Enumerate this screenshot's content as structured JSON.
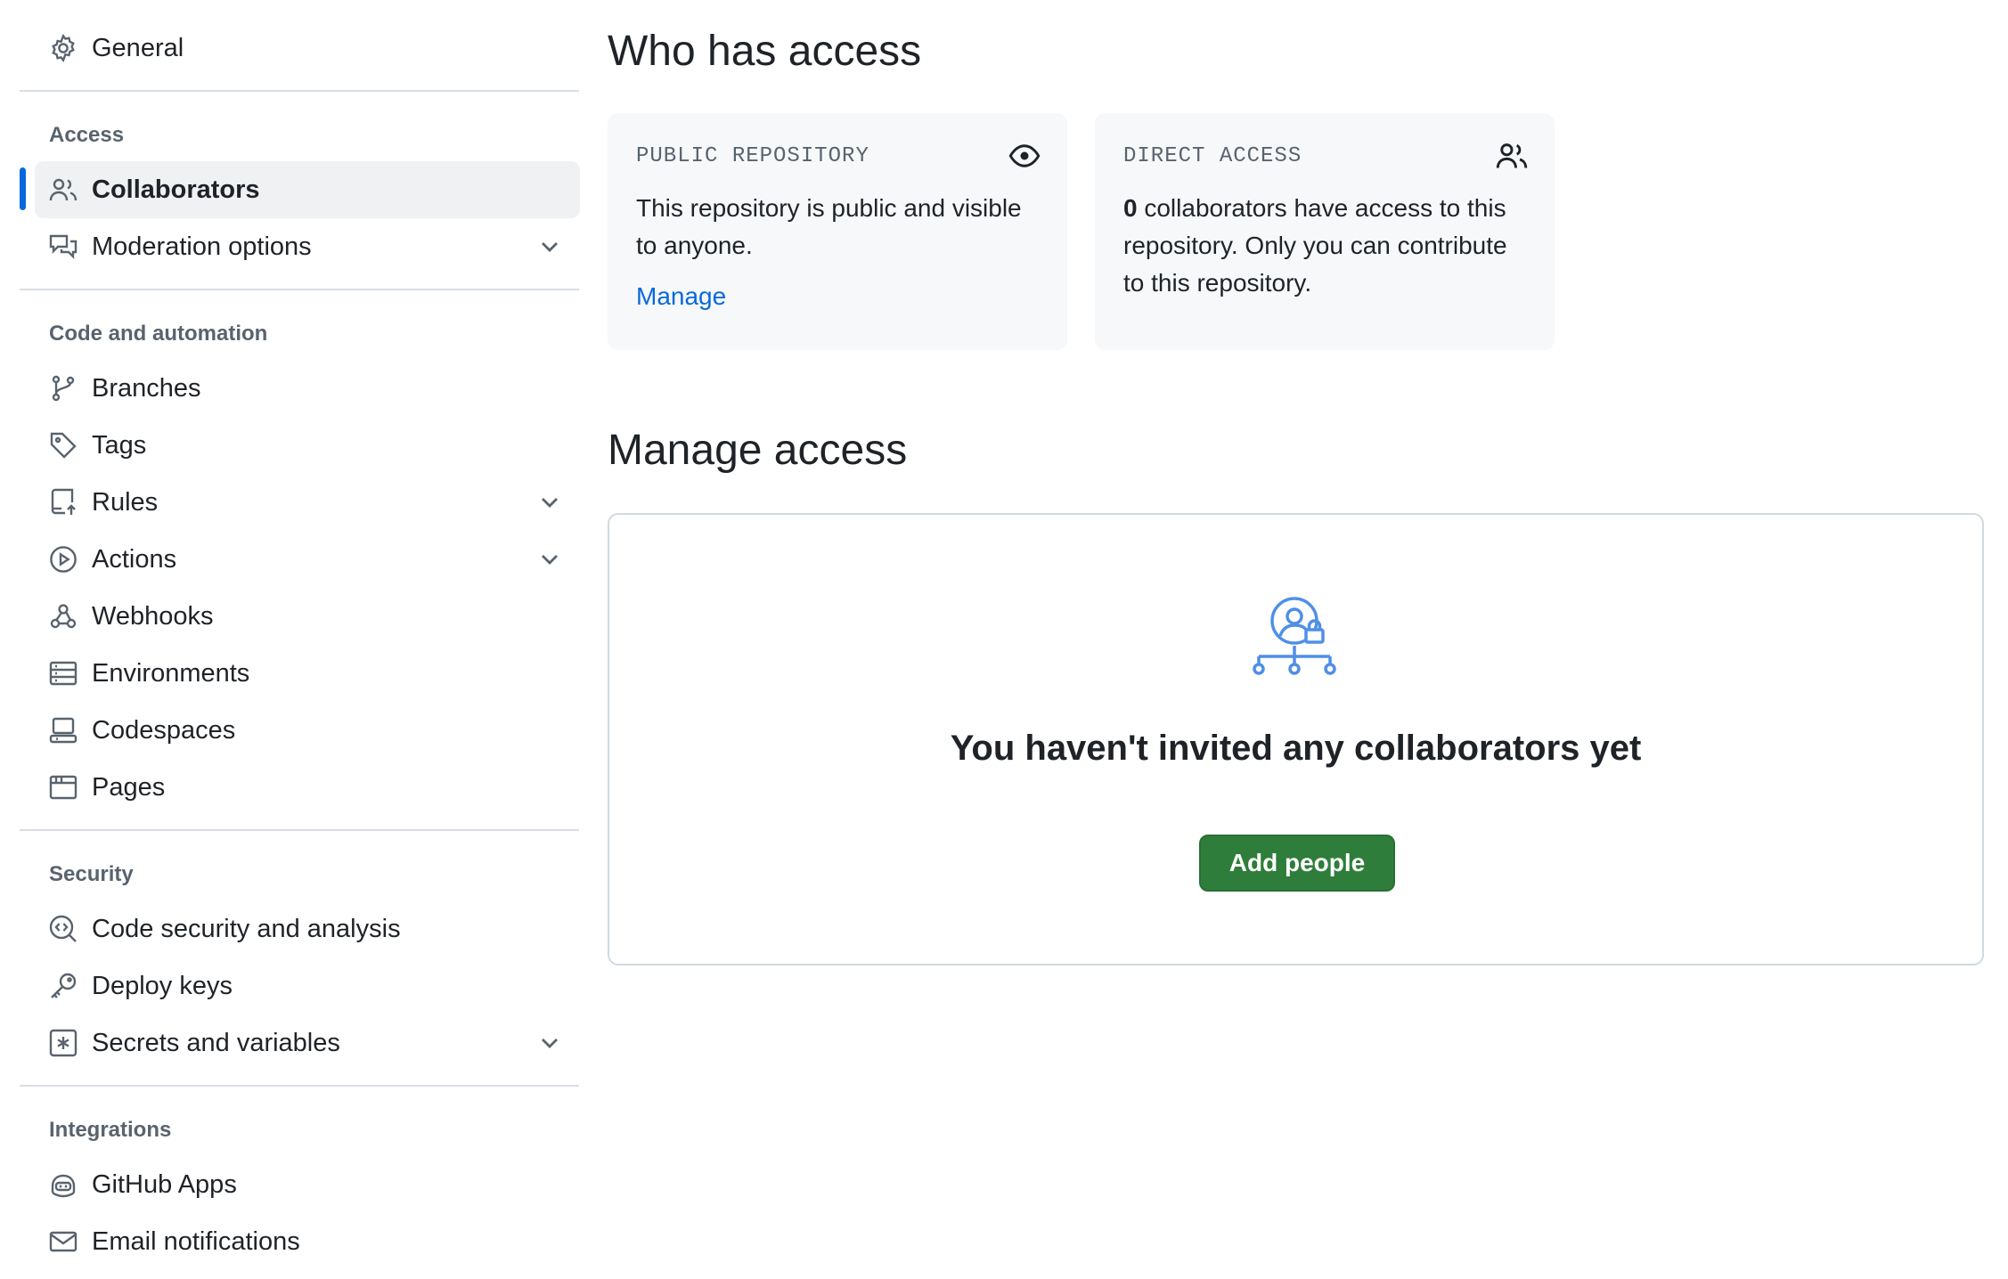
{
  "sidebar": {
    "general": "General",
    "sections": {
      "access": "Access",
      "code": "Code and automation",
      "security": "Security",
      "integrations": "Integrations"
    },
    "items": {
      "collaborators": "Collaborators",
      "moderation": "Moderation options",
      "branches": "Branches",
      "tags": "Tags",
      "rules": "Rules",
      "actions": "Actions",
      "webhooks": "Webhooks",
      "environments": "Environments",
      "codespaces": "Codespaces",
      "pages": "Pages",
      "code_security": "Code security and analysis",
      "deploy_keys": "Deploy keys",
      "secrets": "Secrets and variables",
      "github_apps": "GitHub Apps",
      "email": "Email notifications"
    },
    "active_item": "collaborators"
  },
  "who_has_access": {
    "title": "Who has access",
    "public_card": {
      "heading": "PUBLIC REPOSITORY",
      "text": "This repository is public and visible to anyone.",
      "link": "Manage",
      "icon": "eye-icon"
    },
    "direct_card": {
      "heading": "DIRECT ACCESS",
      "count": "0",
      "text": " collaborators have access to this repository. Only you can contribute to this repository.",
      "icon": "people-icon"
    }
  },
  "manage_access": {
    "title": "Manage access",
    "empty_title": "You haven't invited any collaborators yet",
    "button": "Add people"
  },
  "colors": {
    "accent": "#0969da",
    "button_green": "#2f7d3a"
  }
}
